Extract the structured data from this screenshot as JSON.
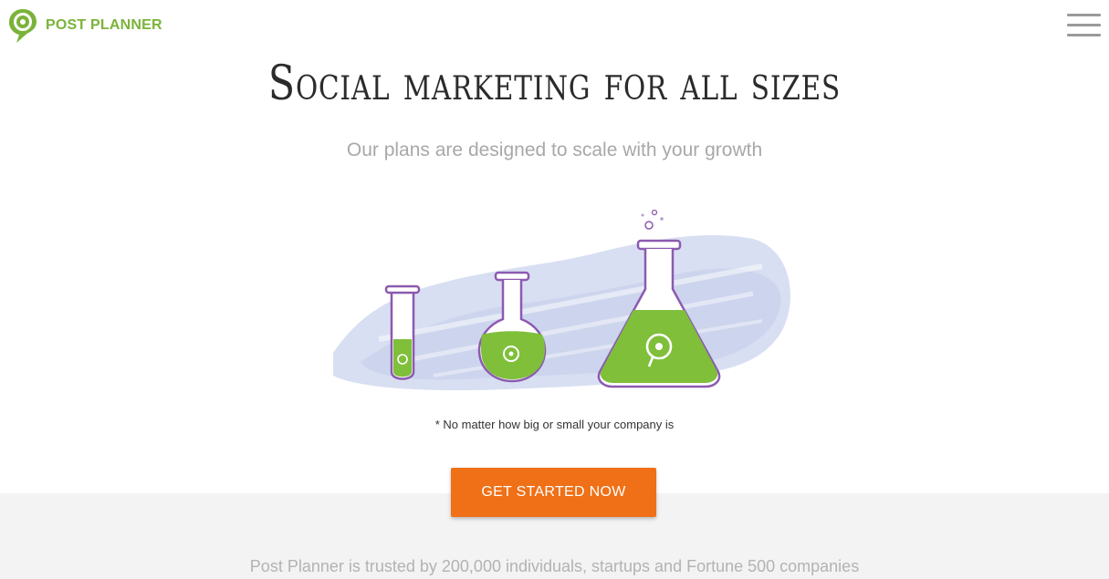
{
  "brand": {
    "name": "POST PLANNER",
    "color": "#7bb33a"
  },
  "header": {
    "menu_icon": "hamburger-menu-icon"
  },
  "hero": {
    "title": "Social marketing for all sizes",
    "subtitle": "Our plans are designed to scale with your growth",
    "illustration": "three-flasks-illustration",
    "footnote": "* No matter how big or small your company is"
  },
  "cta": {
    "label": "GET STARTED NOW",
    "color": "#ef7016"
  },
  "trust": {
    "text": "Post Planner is trusted by 200,000 individuals, startups and Fortune 500 companies"
  }
}
